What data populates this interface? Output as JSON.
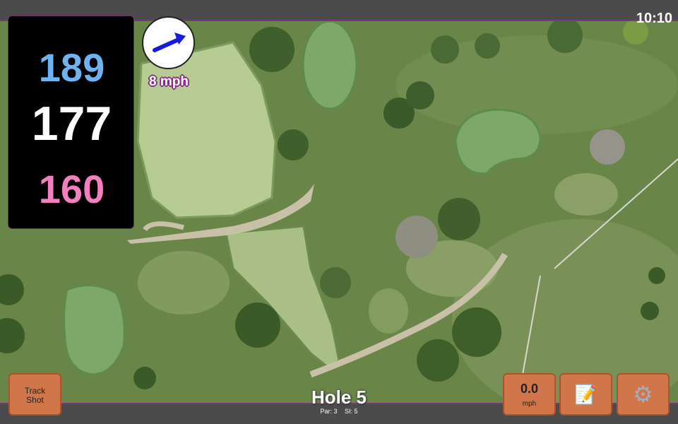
{
  "status_bar": {
    "time": "10:10"
  },
  "yardage": {
    "back": "189",
    "middle": "177",
    "front": "160"
  },
  "wind": {
    "speed_text": "8 mph",
    "direction_icon": "arrow-icon",
    "arrow_color": "#1a1adf"
  },
  "controls": {
    "track_shot_line1": "Track",
    "track_shot_line2": "Shot",
    "speed_value": "0.0",
    "speed_unit": "mph",
    "notes_icon": "notepad-icon",
    "settings_icon": "gear-icon"
  },
  "hole": {
    "title": "Hole 5",
    "par": "Par: 3",
    "si": "SI: 5"
  },
  "colors": {
    "accent": "#d0764a",
    "back_yardage": "#6fb2f0",
    "front_yardage": "#f47fbf",
    "bar_border": "#7a3a78"
  }
}
